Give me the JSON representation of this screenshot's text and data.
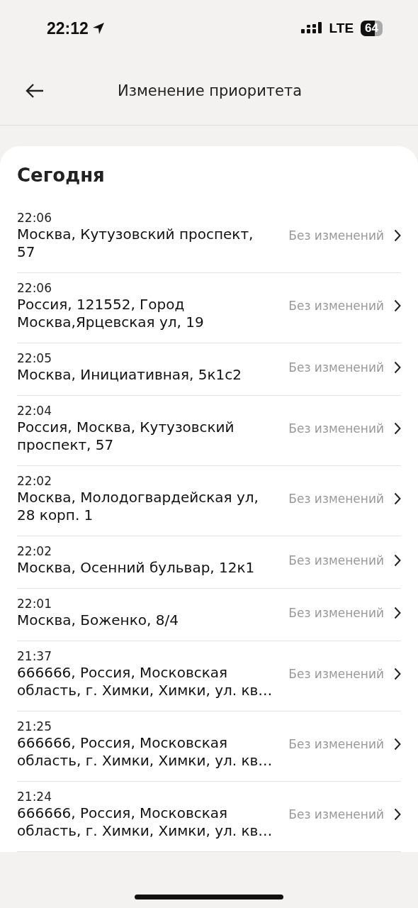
{
  "status_bar": {
    "time": "22:12",
    "network": "LTE",
    "battery": "64"
  },
  "header": {
    "title": "Изменение приоритета"
  },
  "section": {
    "title": "Сегодня"
  },
  "rows": [
    {
      "time": "22:06",
      "address": [
        "Москва, Кутузовский проспект,",
        "57"
      ],
      "status": "Без изменений"
    },
    {
      "time": "22:06",
      "address": [
        "Россия, 121552, Город",
        "Москва,Ярцевская ул, 19"
      ],
      "status": "Без изменений"
    },
    {
      "time": "22:05",
      "address": [
        "Москва, Инициативная, 5к1с2"
      ],
      "status": "Без изменений"
    },
    {
      "time": "22:04",
      "address": [
        "Россия, Москва, Кутузовский",
        "проспект, 57"
      ],
      "status": "Без изменений"
    },
    {
      "time": "22:02",
      "address": [
        "Москва, Молодогвардейская ул,",
        "28 корп. 1"
      ],
      "status": "Без изменений"
    },
    {
      "time": "22:02",
      "address": [
        "Москва, Осенний бульвар, 12к1"
      ],
      "status": "Без изменений"
    },
    {
      "time": "22:01",
      "address": [
        "Москва, Боженко, 8/4"
      ],
      "status": "Без изменений"
    },
    {
      "time": "21:37",
      "address": [
        "666666, Россия, Московская",
        "область, г. Химки, Химки, ул. кв…"
      ],
      "status": "Без изменений"
    },
    {
      "time": "21:25",
      "address": [
        "666666, Россия, Московская",
        "область, г. Химки, Химки, ул. кв…"
      ],
      "status": "Без изменений"
    },
    {
      "time": "21:24",
      "address": [
        "666666, Россия, Московская",
        "область, г. Химки, Химки, ул. кв…"
      ],
      "status": "Без изменений"
    }
  ]
}
